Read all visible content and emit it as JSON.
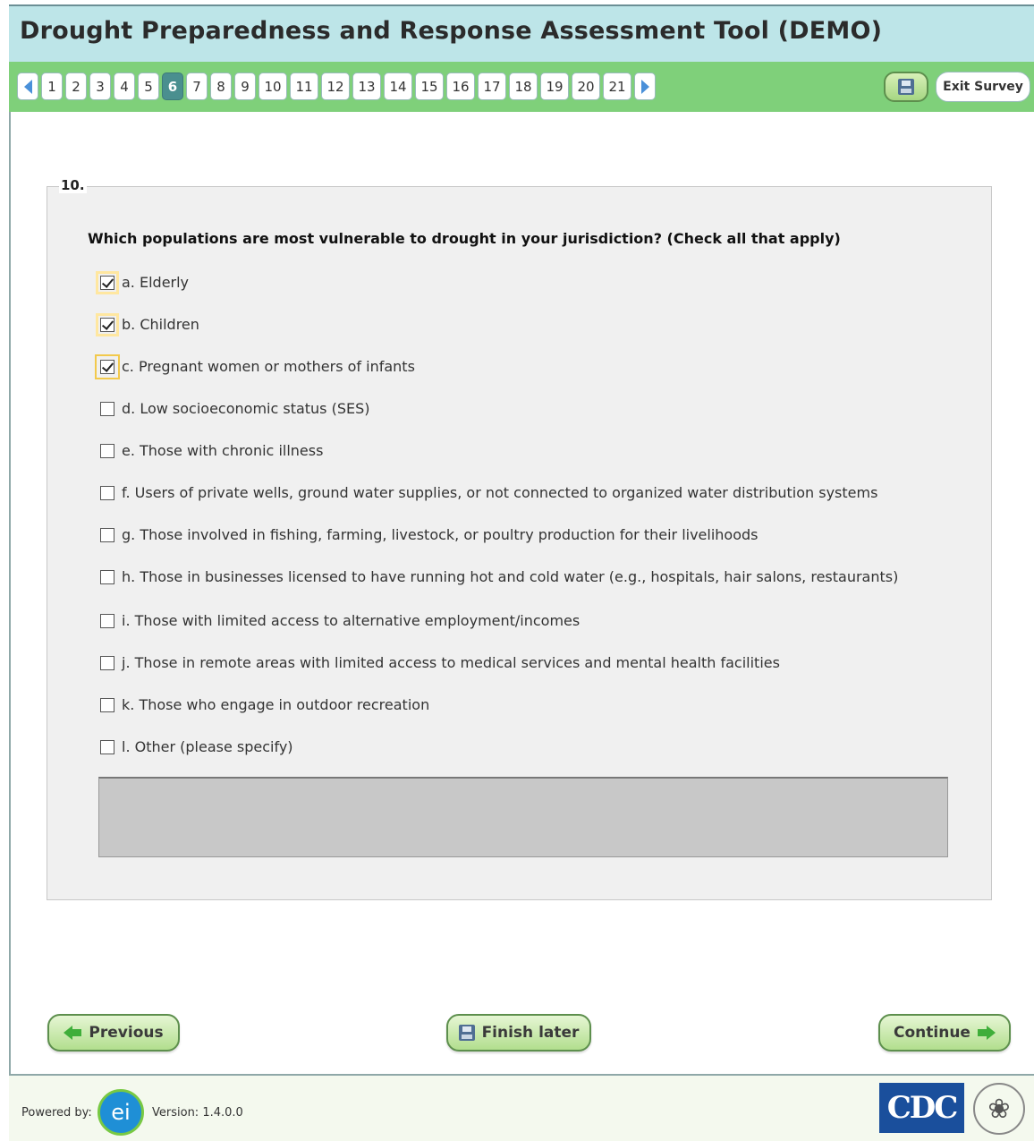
{
  "app": {
    "title": "Drought Preparedness and Response Assessment Tool (DEMO)"
  },
  "nav": {
    "pages": [
      "1",
      "2",
      "3",
      "4",
      "5",
      "6",
      "7",
      "8",
      "9",
      "10",
      "11",
      "12",
      "13",
      "14",
      "15",
      "16",
      "17",
      "18",
      "19",
      "20",
      "21"
    ],
    "active_page": "6",
    "exit_label": "Exit Survey",
    "icons": {
      "prev": "triangle-left-icon",
      "next": "triangle-right-icon",
      "save": "floppy-disk-icon"
    }
  },
  "question": {
    "number": "10.",
    "text": "Which populations are most vulnerable to drought in your jurisdiction? (Check all that apply)",
    "options": [
      {
        "label": "a. Elderly",
        "checked": true
      },
      {
        "label": "b. Children",
        "checked": true
      },
      {
        "label": "c. Pregnant women or mothers of infants",
        "checked": true
      },
      {
        "label": "d. Low socioeconomic status (SES)",
        "checked": false
      },
      {
        "label": "e. Those with chronic illness",
        "checked": false
      },
      {
        "label": "f. Users of private wells, ground water supplies, or not connected to organized water distribution systems",
        "checked": false
      },
      {
        "label": "g. Those involved in fishing, farming, livestock, or poultry production for their livelihoods",
        "checked": false
      },
      {
        "label": "h. Those in businesses licensed to have running hot and cold water (e.g., hospitals, hair salons, restaurants)",
        "checked": false
      },
      {
        "label": "i. Those with limited access to alternative employment/incomes",
        "checked": false
      },
      {
        "label": "j. Those in remote areas with limited access to medical services and mental health facilities",
        "checked": false
      },
      {
        "label": "k. Those who engage in outdoor recreation",
        "checked": false
      },
      {
        "label": "l. Other (please specify)",
        "checked": false
      }
    ],
    "other_text": ""
  },
  "buttons": {
    "previous": "Previous",
    "finish_later": "Finish later",
    "continue": "Continue"
  },
  "footer": {
    "powered_by": "Powered by:",
    "ei_logo_text": "ei",
    "version": "Version: 1.4.0.0",
    "cdc_logo_text": "CDC"
  },
  "colors": {
    "title_bg": "#bde5e8",
    "nav_bg": "#7fd07a",
    "active_page": "#4a8f8f",
    "button_green": "#b2de8e"
  }
}
